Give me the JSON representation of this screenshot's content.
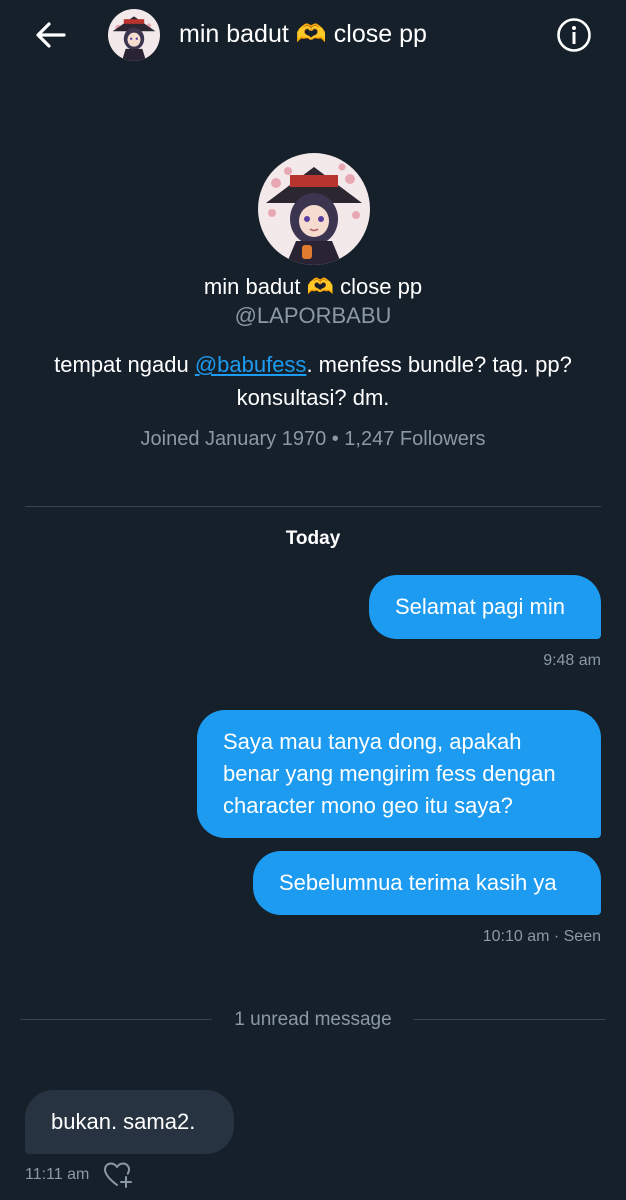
{
  "header": {
    "name": "min badut 🫶 close pp"
  },
  "profile": {
    "name": "min badut 🫶 close pp",
    "handle": "@LAPORBABU",
    "bio_prefix": "tempat ngadu ",
    "bio_mention": "@babufess",
    "bio_suffix": ". menfess bundle? tag. pp? konsultasi? dm.",
    "meta": "Joined January 1970 • 1,247 Followers"
  },
  "conversation": {
    "day_label": "Today",
    "messages": [
      {
        "text": "Selamat pagi min",
        "direction": "outgoing"
      },
      {
        "text": "Saya mau tanya dong, apakah benar yang mengirim fess dengan character mono geo itu saya?",
        "direction": "outgoing"
      },
      {
        "text": "Sebelumnua terima kasih ya",
        "direction": "outgoing"
      },
      {
        "text": "bukan. sama2.",
        "direction": "incoming"
      }
    ],
    "timestamps": {
      "first": "9:48 am",
      "second": "10:10 am · Seen",
      "incoming": "11:11 am"
    },
    "unread_label": "1 unread message"
  },
  "colors": {
    "background": "#15202b",
    "accent": "#1d9bf0",
    "incoming_bubble": "#273340",
    "secondary_text": "#8b98a5"
  },
  "icons": {
    "back": "arrow-left-icon",
    "info": "info-circle-icon",
    "like": "heart-plus-icon"
  }
}
